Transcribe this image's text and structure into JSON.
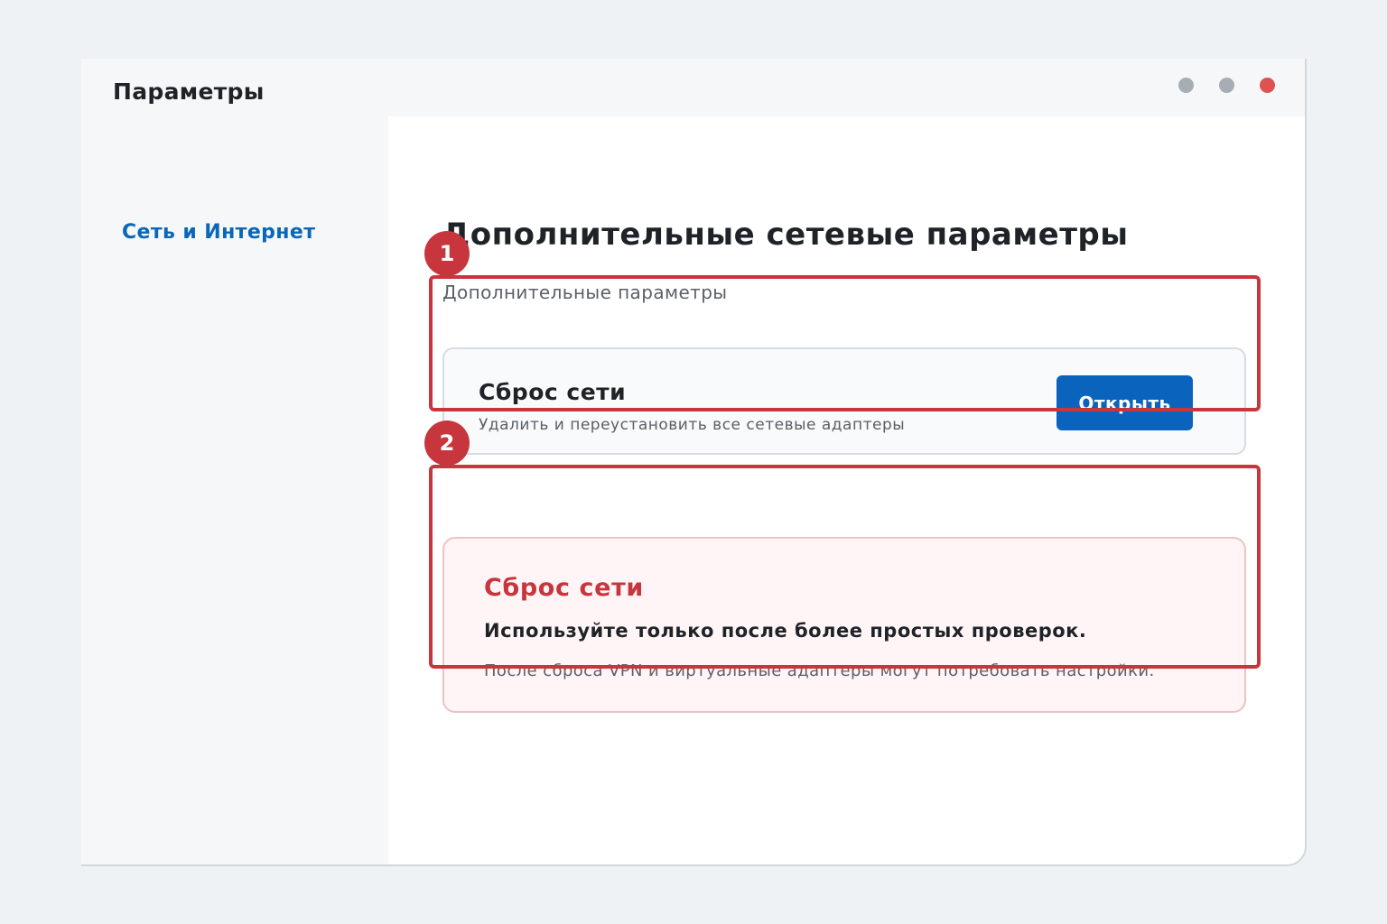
{
  "window": {
    "title": "Параметры"
  },
  "sidebar": {
    "items": [
      {
        "label": "Сеть и Интернет"
      }
    ]
  },
  "main": {
    "page_title": "Дополнительные сетевые параметры",
    "section_label": "Дополнительные параметры",
    "card": {
      "title": "Сброс сети",
      "subtitle": "Удалить и переустановить все сетевые адаптеры",
      "button_label": "Открыть"
    },
    "warning": {
      "title": "Сброс сети",
      "strong_text": "Используйте только после более простых проверок.",
      "note": "После сброса VPN и виртуальные адаптеры могут потребовать настройки."
    }
  },
  "annotations": {
    "badges": [
      "1",
      "2"
    ],
    "color": "#c8363d"
  },
  "colors": {
    "accent": "#0a64be",
    "nav_active": "#0a66b8",
    "warning": "#c8363d",
    "close_dot": "#de5252"
  }
}
